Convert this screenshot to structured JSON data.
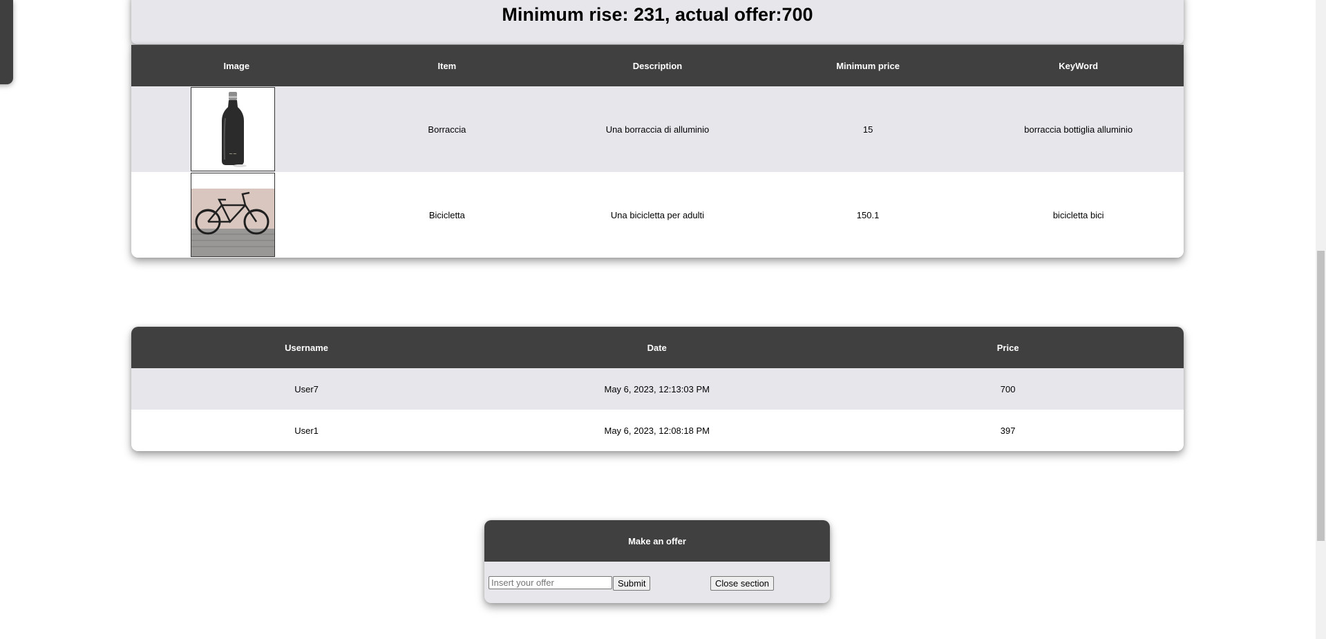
{
  "title": "Minimum rise: 231, actual offer:700",
  "items_table": {
    "headers": [
      "Image",
      "Item",
      "Description",
      "Minimum price",
      "KeyWord"
    ],
    "rows": [
      {
        "image": "water-bottle-photo",
        "item": "Borraccia",
        "description": "Una borraccia di alluminio",
        "min_price": "15",
        "keyword": "borraccia bottiglia alluminio"
      },
      {
        "image": "bicycle-photo",
        "item": "Bicicletta",
        "description": "Una bicicletta per adulti",
        "min_price": "150.1",
        "keyword": "bicicletta bici"
      }
    ]
  },
  "offers_table": {
    "headers": [
      "Username",
      "Date",
      "Price"
    ],
    "rows": [
      {
        "username": "User7",
        "date": "May 6, 2023, 12:13:03 PM",
        "price": "700"
      },
      {
        "username": "User1",
        "date": "May 6, 2023, 12:08:18 PM",
        "price": "397"
      }
    ]
  },
  "offer_form": {
    "heading": "Make an offer",
    "input_placeholder": "Insert your offer",
    "submit_label": "Submit",
    "close_label": "Close section"
  },
  "colors": {
    "header_bg": "#404040",
    "row_alt_bg": "#e7e6eb"
  }
}
